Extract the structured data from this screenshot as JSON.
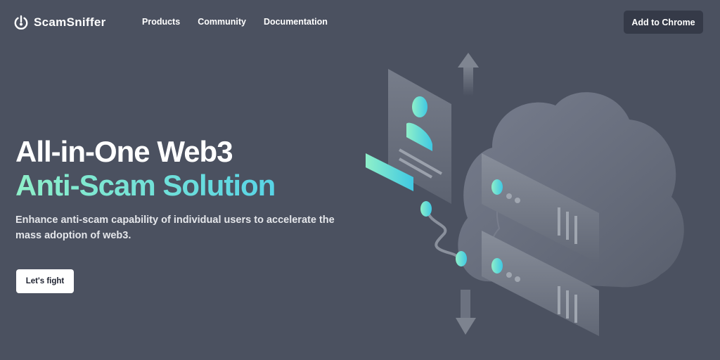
{
  "header": {
    "brand": "ScamSniffer",
    "logo_icon": "power-icon",
    "nav": [
      {
        "label": "Products"
      },
      {
        "label": "Community"
      },
      {
        "label": "Documentation"
      }
    ],
    "cta_label": "Add to Chrome"
  },
  "hero": {
    "title_line1": "All-in-One Web3",
    "title_line2": "Anti-Scam Solution",
    "subtitle": "Enhance anti-scam capability of individual users to accelerate the mass adoption of web3.",
    "cta_label": "Let's fight"
  },
  "colors": {
    "background": "#4b5160",
    "accent_start": "#8ff0c9",
    "accent_end": "#58d4e6",
    "cta_dark": "#353a48"
  }
}
